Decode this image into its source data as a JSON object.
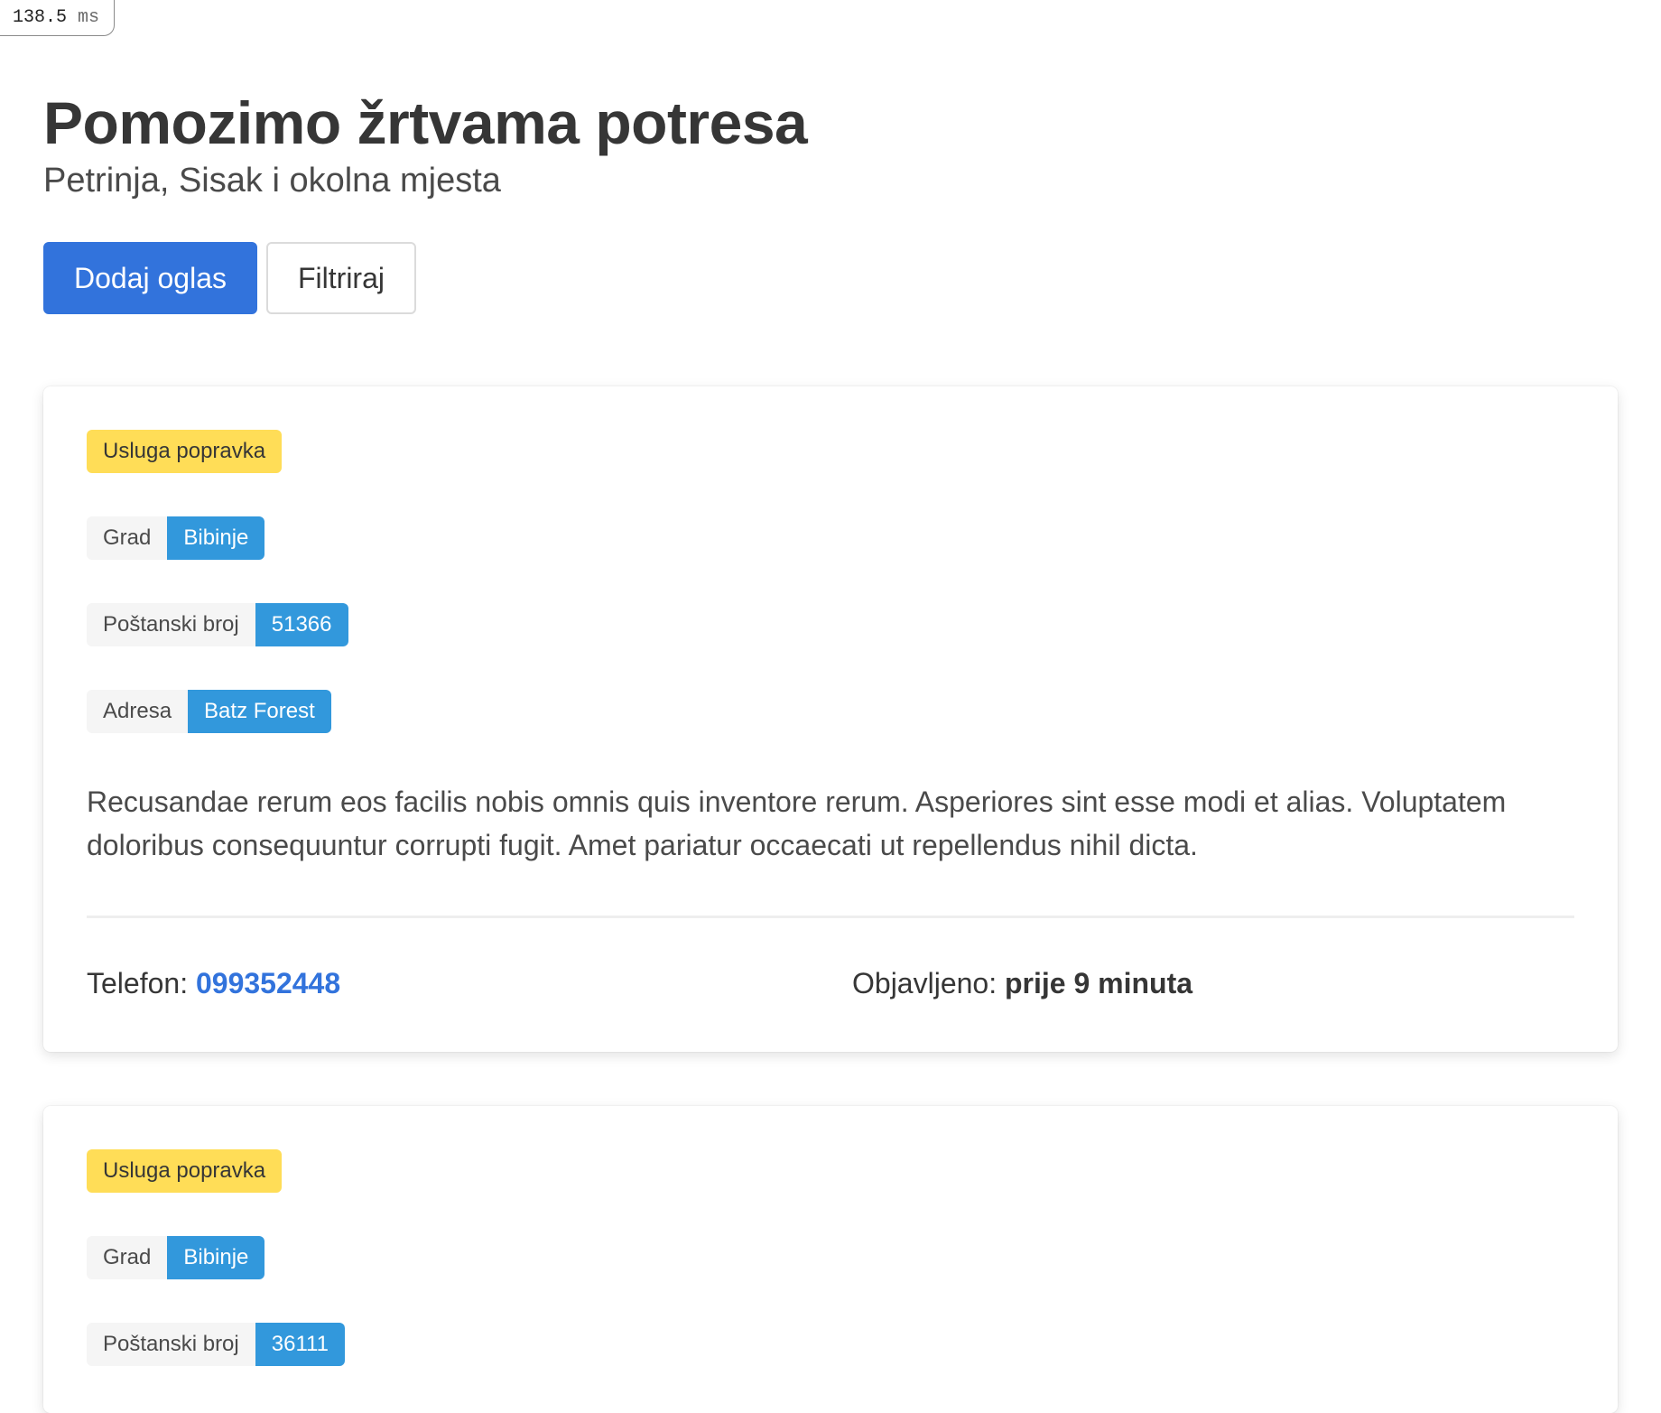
{
  "timer": {
    "value": "138.5",
    "unit": "ms"
  },
  "header": {
    "title": "Pomozimo žrtvama potresa",
    "subtitle": "Petrinja, Sisak i okolna mjesta"
  },
  "actions": {
    "add_label": "Dodaj oglas",
    "filter_label": "Filtriraj"
  },
  "colors": {
    "primary": "#3273dc",
    "info": "#3298dc",
    "warning": "#ffdd57"
  },
  "listings": [
    {
      "category": "Usluga popravka",
      "city_label": "Grad",
      "city": "Bibinje",
      "postal_label": "Poštanski broj",
      "postal": "51366",
      "address_label": "Adresa",
      "address": "Batz Forest",
      "description": "Recusandae rerum eos facilis nobis omnis quis inventore rerum. Asperiores sint esse modi et alias. Voluptatem doloribus consequuntur corrupti fugit. Amet pariatur occaecati ut repellendus nihil dicta.",
      "phone_label": "Telefon:",
      "phone": "099352448",
      "posted_label": "Objavljeno:",
      "posted": "prije 9 minuta"
    },
    {
      "category": "Usluga popravka",
      "city_label": "Grad",
      "city": "Bibinje",
      "postal_label": "Poštanski broj",
      "postal": "36111"
    }
  ]
}
